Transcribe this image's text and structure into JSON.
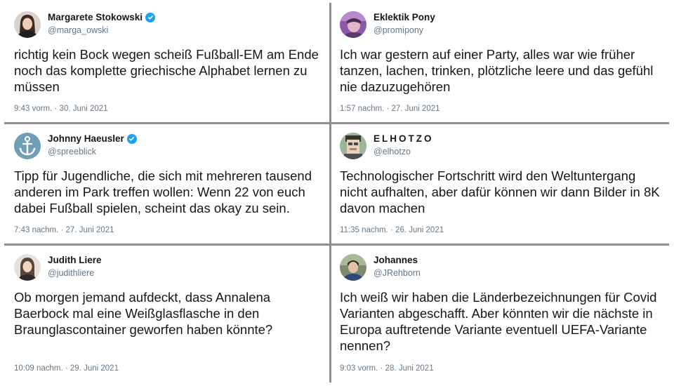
{
  "tweets": [
    {
      "name": "Margarete Stokowski",
      "verified": true,
      "handle": "@marga_owski",
      "text": "richtig kein Bock wegen scheiß Fußball-EM am Ende noch das komplette griechische Alphabet lernen zu müssen",
      "meta": "9:43 vorm. · 30. Juni 2021",
      "avatar_icon": "woman-portrait-avatar"
    },
    {
      "name": "Eklektik Pony",
      "verified": false,
      "handle": "@promipony",
      "text": "Ich war gestern auf einer Party, alles war wie früher tanzen, lachen, trinken, plötzliche leere und das gefühl nie dazuzugehören",
      "meta": "1:57 nachm. · 27. Juni 2021",
      "avatar_icon": "purple-portrait-avatar"
    },
    {
      "name": "Johnny Haeusler",
      "verified": true,
      "handle": "@spreeblick",
      "text": "Tipp für Jugendliche, die sich mit mehreren tausend anderen im Park treffen wollen: Wenn 22 von euch dabei Fußball spielen, scheint das okay zu sein.",
      "meta": "7:43 nachm. · 27. Juni 2021",
      "avatar_icon": "anchor-avatar"
    },
    {
      "name": "ELHOTZO",
      "verified": false,
      "handle": "@elhotzo",
      "text": "Technologischer Fortschritt wird den Weltuntergang nicht aufhalten, aber dafür können wir dann Bilder in 8K davon machen",
      "meta": "11:35 nachm. · 26. Juni 2021",
      "avatar_icon": "pixelated-face-avatar"
    },
    {
      "name": "Judith Liere",
      "verified": false,
      "handle": "@judithliere",
      "text": "Ob morgen jemand aufdeckt, dass Annalena Baerbock mal eine Weißglasflasche in den Braunglascontainer geworfen haben könnte?",
      "meta": "10:09 nachm. · 29. Juni 2021",
      "avatar_icon": "woman-portrait-avatar"
    },
    {
      "name": "Johannes",
      "verified": false,
      "handle": "@JRehborn",
      "text": "Ich weiß wir haben die Länderbezeichnungen für Covid Varianten abgeschafft. Aber könnten wir die nächste in Europa auftretende Variante eventuell UEFA-Variante nennen?",
      "meta": "9:03 vorm. · 28. Juni 2021",
      "avatar_icon": "man-portrait-avatar"
    }
  ],
  "colors": {
    "verified": "#1da1f2",
    "handle": "#657786",
    "text": "#14171a",
    "divider": "#8d8d8d"
  }
}
